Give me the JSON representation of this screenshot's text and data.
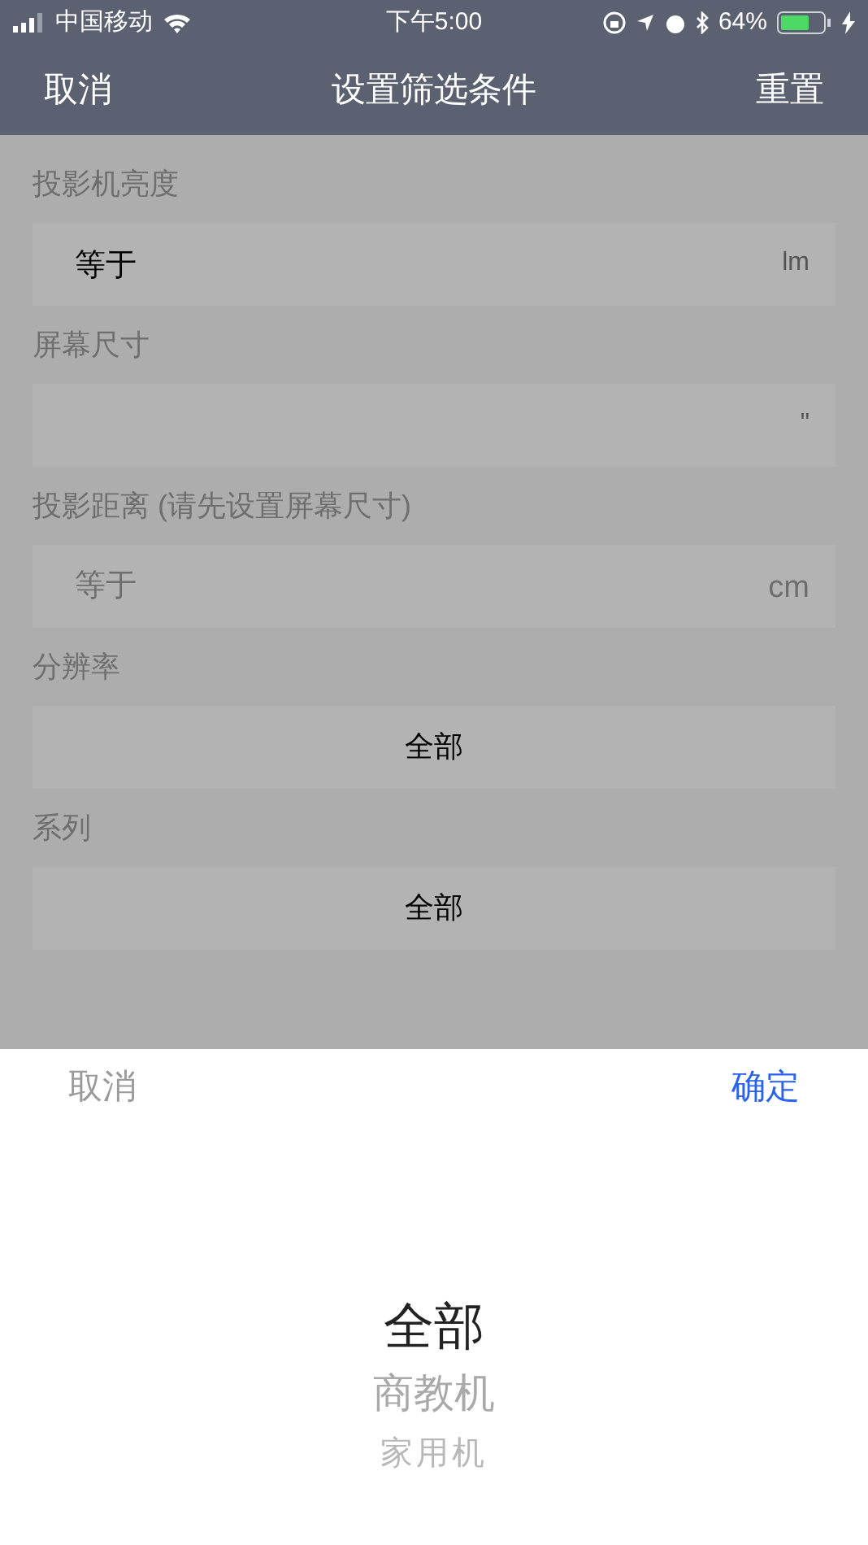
{
  "status_bar": {
    "carrier": "中国移动",
    "time": "下午5:00",
    "battery": "64%"
  },
  "nav": {
    "left": "取消",
    "title": "设置筛选条件",
    "right": "重置"
  },
  "fields": [
    {
      "label": "投影机亮度",
      "kind": "input",
      "value": "等于",
      "unit": "lm"
    },
    {
      "label": "屏幕尺寸",
      "kind": "input",
      "unit": "\""
    },
    {
      "label": "投影距离 (请先设置屏幕尺寸)",
      "kind": "input",
      "placeholder": "等于",
      "unit": "cm"
    },
    {
      "label": "分辨率",
      "kind": "select",
      "value": "全部"
    },
    {
      "label": "系列",
      "kind": "select",
      "value": "全部"
    }
  ],
  "picker": {
    "cancel": "取消",
    "confirm": "确定",
    "items": [
      {
        "label": "全部",
        "selected": true
      },
      {
        "label": "商教机",
        "selected": false
      },
      {
        "label": "家用机",
        "selected": false
      }
    ]
  }
}
